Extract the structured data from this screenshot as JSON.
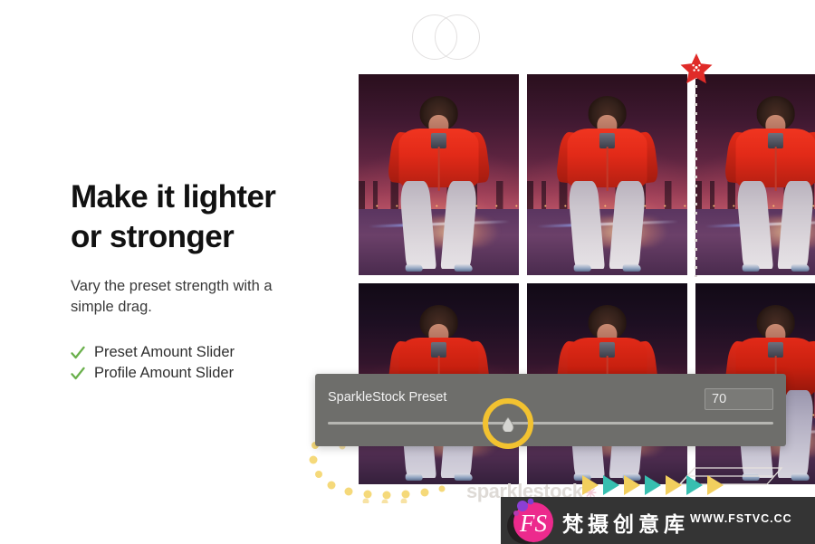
{
  "headline": "Make it lighter\nor stronger",
  "subcopy": "Vary the preset strength with a\nsimple drag.",
  "features": [
    {
      "label": "Preset Amount Slider",
      "icon": "check-icon"
    },
    {
      "label": "Profile Amount Slider",
      "icon": "check-icon"
    }
  ],
  "slider_panel": {
    "label": "SparkleStock Preset",
    "value": "70",
    "handle_position_percent": 41
  },
  "gallery": {
    "rows": 2,
    "columns": 3,
    "items": [
      {
        "alt": "woman-in-red-sweater-night-city-warm-grade"
      },
      {
        "alt": "woman-in-red-sweater-night-city-warm-grade"
      },
      {
        "alt": "woman-in-red-sweater-night-city-warm-grade"
      },
      {
        "alt": "woman-in-red-sweater-night-city-dark-grade"
      },
      {
        "alt": "woman-in-red-sweater-night-city-dark-grade"
      },
      {
        "alt": "woman-in-red-sweater-night-city-dark-grade"
      }
    ]
  },
  "watermarks": {
    "sparklestock": "sparklestock",
    "sparklestock_star": "✳",
    "brand_cn": "梵摄创意库",
    "brand_url": "WWW.FSTVC.CC",
    "brand_logo_text": "FS"
  },
  "arrows": [
    {
      "color": "#f2cf5e"
    },
    {
      "color": "#37bfb0"
    },
    {
      "color": "#f2cf5e"
    },
    {
      "color": "#37bfb0"
    },
    {
      "color": "#f2cf5e"
    },
    {
      "color": "#37bfb0"
    },
    {
      "color": "#f2cf5e"
    }
  ],
  "colors": {
    "background": "#ffffff",
    "headline": "#111111",
    "body_text": "#3a3a3a",
    "check_green": "#6ab04c",
    "panel_gray": "#6e6e6b",
    "ring_yellow": "#f2c230",
    "star_red": "#e02b28",
    "arrow_yellow": "#f2cf5e",
    "arrow_teal": "#37bfb0",
    "watermark_bar": "#343434",
    "logo_pink": "#ec2a8d"
  }
}
